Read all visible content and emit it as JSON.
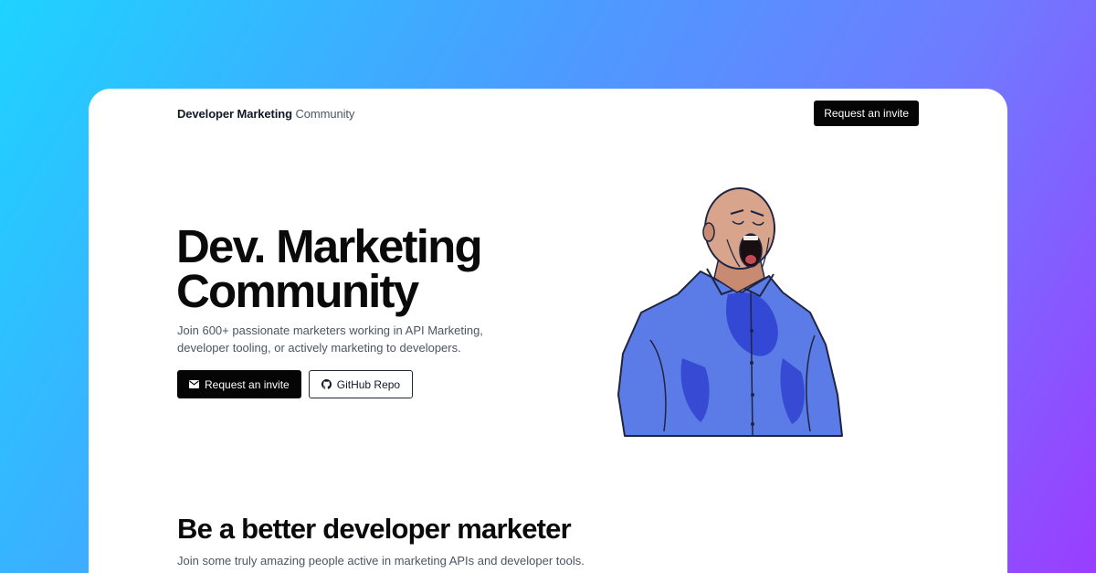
{
  "nav": {
    "brand_bold": "Developer Marketing",
    "brand_light": "Community",
    "cta_label": "Request an invite"
  },
  "hero": {
    "title_line1": "Dev. Marketing",
    "title_line2": "Community",
    "subtitle": "Join 600+ passionate marketers working in API Marketing, developer tooling, or actively marketing to developers.",
    "primary_button": {
      "label": "Request an invite",
      "icon": "mail-icon"
    },
    "secondary_button": {
      "label": "GitHub Repo",
      "icon": "github-icon"
    },
    "illustration": "shouting-man-illustration"
  },
  "section": {
    "title": "Be a better developer marketer",
    "subtitle": "Join some truly amazing people active in marketing APIs and developer tools."
  },
  "colors": {
    "gradient_start": "#1ed3ff",
    "gradient_end": "#9a3dff",
    "button_bg": "#050505",
    "text_dark": "#0a0a0a",
    "text_muted": "#4b5563",
    "shirt_blue": "#5b7be6"
  }
}
